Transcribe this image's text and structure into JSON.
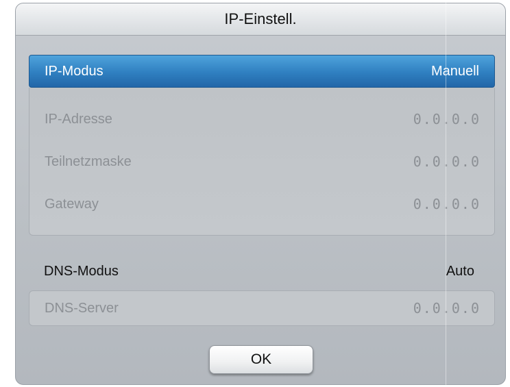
{
  "dialog": {
    "title": "IP-Einstell."
  },
  "ip_mode": {
    "label": "IP-Modus",
    "value": "Manuell"
  },
  "ip_fields": [
    {
      "label": "IP-Adresse",
      "value": "0.0.0.0"
    },
    {
      "label": "Teilnetzmaske",
      "value": "0.0.0.0"
    },
    {
      "label": "Gateway",
      "value": "0.0.0.0"
    }
  ],
  "dns_mode": {
    "label": "DNS-Modus",
    "value": "Auto"
  },
  "dns_server": {
    "label": "DNS-Server",
    "value": "0.0.0.0"
  },
  "ok_button": {
    "label": "OK"
  },
  "colors": {
    "selection": "#2f7fc0",
    "dialog_bg": "#bbc0c5",
    "disabled_text": "#8c9095"
  }
}
